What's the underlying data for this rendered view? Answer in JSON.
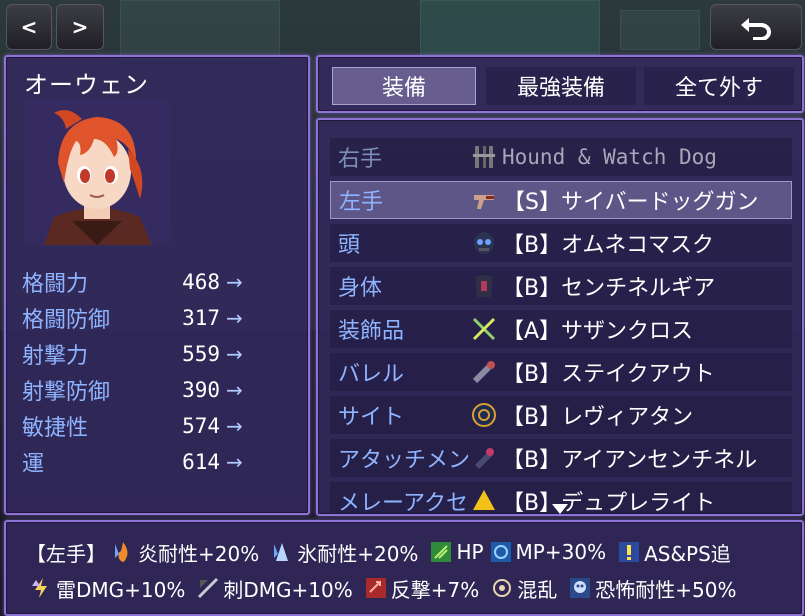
{
  "nav": {
    "prev_label": "<",
    "next_label": ">",
    "back_icon": "undo-arrow-icon"
  },
  "actor": {
    "name": "オーウェン",
    "portrait": "red-haired-character-portrait"
  },
  "stats": [
    {
      "label": "格闘力",
      "value": "468",
      "arrow": "→"
    },
    {
      "label": "格闘防御",
      "value": "317",
      "arrow": "→"
    },
    {
      "label": "射撃力",
      "value": "559",
      "arrow": "→"
    },
    {
      "label": "射撃防御",
      "value": "390",
      "arrow": "→"
    },
    {
      "label": "敏捷性",
      "value": "574",
      "arrow": "→"
    },
    {
      "label": "運",
      "value": "614",
      "arrow": "→"
    }
  ],
  "commands": [
    {
      "label": "装備",
      "selected": true
    },
    {
      "label": "最強装備",
      "selected": false
    },
    {
      "label": "全て外す",
      "selected": false
    }
  ],
  "slots": [
    {
      "slot": "右手",
      "icon": "sealed-weapon-icon",
      "item": "Hound & Watch Dog",
      "dimmed": true,
      "selected": false
    },
    {
      "slot": "左手",
      "icon": "gun-icon",
      "item": "【S】サイバードッグガン",
      "dimmed": false,
      "selected": true
    },
    {
      "slot": "頭",
      "icon": "mask-icon",
      "item": "【B】オムネコマスク",
      "dimmed": false,
      "selected": false
    },
    {
      "slot": "身体",
      "icon": "armor-icon",
      "item": "【B】センチネルギア",
      "dimmed": false,
      "selected": false
    },
    {
      "slot": "装飾品",
      "icon": "crossed-swords-icon",
      "item": "【A】サザンクロス",
      "dimmed": false,
      "selected": false
    },
    {
      "slot": "バレル",
      "icon": "barrel-icon",
      "item": "【B】ステイクアウト",
      "dimmed": false,
      "selected": false
    },
    {
      "slot": "サイト",
      "icon": "scope-icon",
      "item": "【B】レヴィアタン",
      "dimmed": false,
      "selected": false
    },
    {
      "slot": "アタッチメント",
      "icon": "attachment-icon",
      "item": "【B】アイアンセンチネル",
      "dimmed": false,
      "selected": false
    },
    {
      "slot": "メレーアクセ",
      "icon": "melee-accessory-icon",
      "item": "【B】デュプレライト",
      "dimmed": false,
      "selected": false
    }
  ],
  "help": {
    "prefix": "【左手】",
    "line1": [
      {
        "icon": "fire-resist-icon",
        "text": "炎耐性+20%"
      },
      {
        "icon": "ice-resist-icon",
        "text": "氷耐性+20%"
      },
      {
        "icon": "hp-icon",
        "text": "HP"
      },
      {
        "icon": "mp-icon",
        "text": "MP+30%"
      },
      {
        "icon": "as-ps-icon",
        "text": "AS&PS追"
      }
    ],
    "line2": [
      {
        "icon": "thunder-dmg-icon",
        "text": "雷DMG+10%"
      },
      {
        "icon": "pierce-dmg-icon",
        "text": "刺DMG+10%"
      },
      {
        "icon": "counter-icon",
        "text": "反撃+7%"
      },
      {
        "icon": "confusion-icon",
        "text": "混乱"
      },
      {
        "icon": "fear-resist-icon",
        "text": "恐怖耐性+50%"
      }
    ]
  },
  "colors": {
    "window_border": "#8f72d6",
    "window_bg": "#342a60",
    "label_blue": "#8fb4ff"
  }
}
